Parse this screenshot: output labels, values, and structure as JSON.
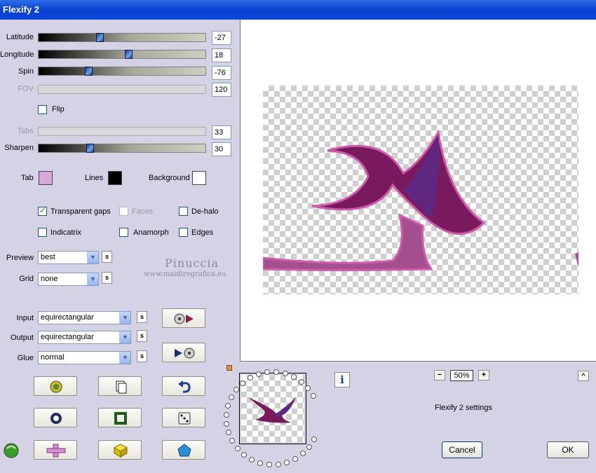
{
  "window": {
    "title": "Flexify 2"
  },
  "sliders": [
    {
      "label": "Latitude",
      "value": "-27",
      "level": 0.36,
      "disabled": false
    },
    {
      "label": "Longitude",
      "value": "18",
      "level": 0.54,
      "disabled": false
    },
    {
      "label": "Spin",
      "value": "-76",
      "level": 0.29,
      "disabled": false
    },
    {
      "label": "FOV",
      "value": "120",
      "level": null,
      "disabled": true
    },
    {
      "label": "Tabs",
      "value": "33",
      "level": null,
      "disabled": true
    },
    {
      "label": "Sharpen",
      "value": "30",
      "level": 0.3,
      "disabled": false
    }
  ],
  "flip": {
    "label": "Flip",
    "checked": false
  },
  "colors": {
    "tab": {
      "label": "Tab",
      "color": "#d9a8d9"
    },
    "lines": {
      "label": "Lines",
      "color": "#000000"
    },
    "background": {
      "label": "Background",
      "color": "#ffffff"
    }
  },
  "options": {
    "transparent_gaps": {
      "label": "Transparent gaps",
      "checked": true
    },
    "faces": {
      "label": "Faces",
      "checked": false,
      "disabled": true
    },
    "de_halo": {
      "label": "De-halo",
      "checked": false
    },
    "indicatrix": {
      "label": "Indicatrix",
      "checked": false
    },
    "anamorph": {
      "label": "Anamorph",
      "checked": false
    },
    "edges": {
      "label": "Edges",
      "checked": false
    }
  },
  "preview": {
    "label": "Preview",
    "value": "best"
  },
  "grid": {
    "label": "Grid",
    "value": "none"
  },
  "watermark": {
    "name": "Pinuccia",
    "site": "www.maidiregrafica.eu"
  },
  "input": {
    "label": "Input",
    "value": "equirectangular"
  },
  "output": {
    "label": "Output",
    "value": "equirectangular"
  },
  "glue": {
    "label": "Glue",
    "value": "normal"
  },
  "small_button": {
    "label": "s"
  },
  "zoom": {
    "value": "50%",
    "minus": "−",
    "plus": "+"
  },
  "info_button": {
    "label": "i"
  },
  "collapse_button": {
    "label": "^"
  },
  "settings_label": "Flexify 2 settings",
  "buttons": {
    "cancel": "Cancel",
    "ok": "OK"
  },
  "toolbar_icons": [
    "randomize-globe-icon",
    "copy-icon",
    "undo-icon",
    "ring-icon",
    "square-icon",
    "dice-icon",
    "cross-net-icon",
    "cube-icon",
    "pentagon-icon"
  ]
}
